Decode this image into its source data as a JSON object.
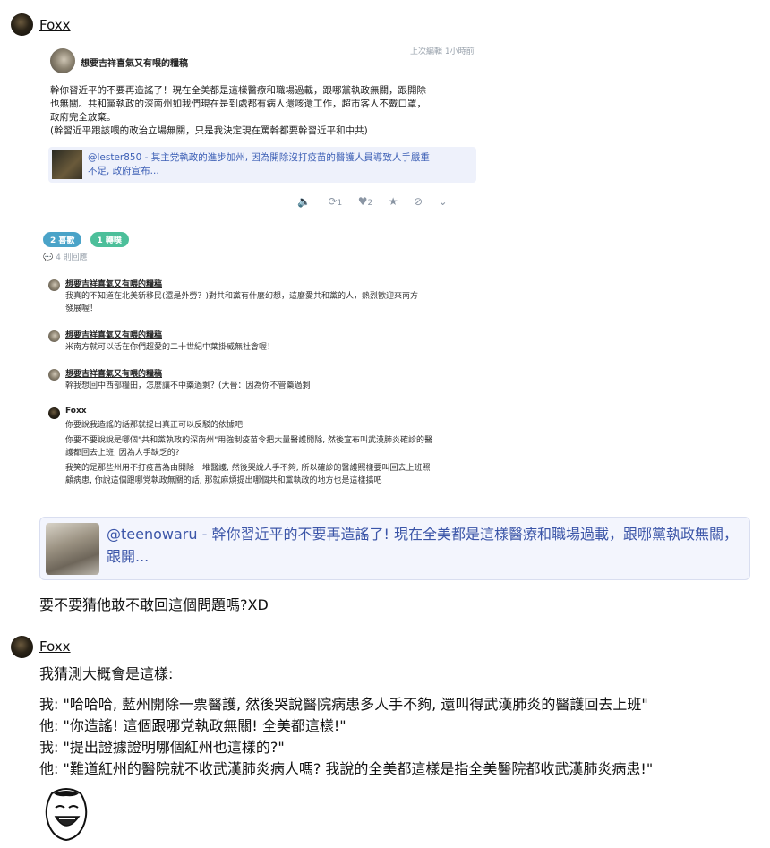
{
  "post1": {
    "username": "Foxx",
    "screenshot": {
      "author": "想要吉祥喜氣又有喂的糧稿",
      "edited": "上次編輯 1小時前",
      "body_lines": [
        "幹你習近平的不要再造謠了！現在全美都是這樣醫療和職場過載，跟哪黨執政無關，跟開除",
        "也無關。共和黨執政的深南州如我們現在是到處都有病人還咳還工作，超市客人不戴口罩，",
        "政府完全放棄。",
        "(幹習近平跟該喂的政治立場無關，只是我決定現在罵幹都要幹習近平和中共)"
      ],
      "quote_line1": "@lester850 - 其主党執政的進步加州, 因為開除沒打疫苗的醫護人員導致人手嚴重",
      "quote_line2": "不足, 政府宣布...",
      "action_counts": {
        "reblogs": "1",
        "likes": "2"
      },
      "pill_likes": "2 喜歡",
      "pill_shares": "1 轉噗",
      "comment_count": "4 則回應",
      "comments": [
        {
          "name": "想要吉祥喜氣又有喂的糧稿",
          "lines": [
            "我真的不知道在北美新移民(還是外勞？)對共和黨有什麼幻想，這麼愛共和黨的人，熱烈歡迎來南方",
            "發展喔！"
          ]
        },
        {
          "name": "想要吉祥喜氣又有喂的糧稿",
          "lines": [
            "米南方就可以活在你們超愛的二十世紀中葉掛威無社會喔！"
          ]
        },
        {
          "name": "想要吉祥喜氣又有喂的糧稿",
          "lines": [
            "幹我想回中西部糧田，怎麼讓不中藥過剩？(大晉：因為你不管藥過剩"
          ]
        },
        {
          "name": "Foxx",
          "lines": [
            "你要說我造謠的話那就提出真正可以反駁的依據吧",
            "你要不要說說是哪個\"共和黨執政的深南州\"用強制疫苗令把大量醫護開除, 然後宣布叫武漢肺炎確診的醫",
            "護都回去上班, 因為人手缺乏的?",
            "我笑的是那些州用不打疫苗為由開除一堆醫護, 然後哭說人手不夠, 所以確診的醫護照樣要叫回去上班照",
            "顧病患, 你說這個跟哪党執政無關的話, 那就麻煩提出哪個共和黨執政的地方也是這樣搞吧"
          ]
        }
      ]
    },
    "big_quote": "@teenowaru - 幹你習近平的不要再造謠了! 現在全美都是這樣醫療和職場過載，跟哪黨執政無關，跟開...",
    "text": "要不要猜他敢不敢回這個問題嗎?XD"
  },
  "post2": {
    "username": "Foxx",
    "lines": [
      "我猜測大概會是這樣:",
      "我: \"哈哈哈, 藍州開除一票醫護, 然後哭說醫院病患多人手不夠, 還叫得武漢肺炎的醫護回去上班\"",
      "他: \"你造謠! 這個跟哪党執政無關! 全美都這樣!\"",
      "我: \"提出證據證明哪個紅州也這樣的?\"",
      "他: \"難道紅州的醫院就不收武漢肺炎病人嗎? 我說的全美都這樣是指全美醫院都收武漢肺炎病患!\""
    ]
  },
  "colors": {
    "pill_blue": "#4aa3c8",
    "pill_green": "#4cbf9a",
    "link": "#3c5fb5"
  }
}
